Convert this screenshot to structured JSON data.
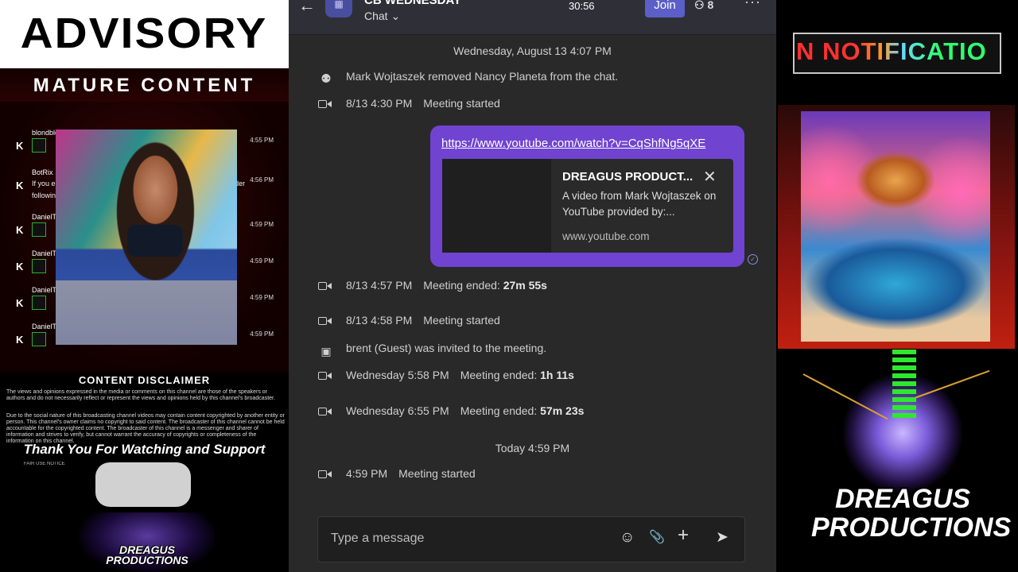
{
  "overlay_left": {
    "advisory": "ADVISORY",
    "mature": "MATURE CONTENT",
    "stream_chat": [
      {
        "user": "blondblondbz",
        "message": "",
        "time": "4:55 PM"
      },
      {
        "user": "BotRix",
        "message": "If you enjoy the content and would like to see more please consider following and activating notifications!",
        "time": "4:56 PM"
      },
      {
        "user": "DanielTrika",
        "message": "",
        "time": "4:59 PM"
      },
      {
        "user": "DanielTrika",
        "message": "",
        "time": "4:59 PM"
      },
      {
        "user": "DanielTrika",
        "message": "",
        "time": "4:59 PM"
      },
      {
        "user": "DanielTrika",
        "message": "",
        "time": "4:59 PM"
      }
    ],
    "platform_letter": "K",
    "disclaimer_title": "CONTENT DISCLAIMER",
    "disclaimer_1": "The views and opinions expressed in the media or comments on this channel are those of the speakers or authors and do not necessarily reflect or represent the views and opinions held by this channel's broadcaster.",
    "disclaimer_2": "Due to the social nature of this broadcasting channel videos may contain content copyrighted by another entity or person. This channel's owner claims no copyright to said content. The broadcaster of this channel cannot be held accountable for the copyrighted content. The broadcaster of this channel is a messenger and sharer of information and strives to verify, but cannot warrant the accuracy of copyrights or completeness of the information on this channel.",
    "thanks": "Thank You For Watching and Support",
    "fair_use_title": "FAIR USE NOTICE",
    "logo_text": "DREAGUS PRODUCTIONS"
  },
  "teams": {
    "chat_title": "CB WEDNESDAY",
    "chat_subtitle": "Chat ⌄",
    "group_avatar_icon": "calendar-icon",
    "call_timer": "30:56",
    "join_label": "Join",
    "people_count": "8",
    "more_label": "···",
    "day_dividers": [
      "Wednesday, August 13 4:07 PM",
      "Today 4:59 PM"
    ],
    "events": [
      {
        "icon": "person-removed-icon",
        "time": "",
        "text": "Mark Wojtaszek removed Nancy Planeta from the chat.",
        "bold": ""
      },
      {
        "icon": "camera-icon",
        "time": "8/13 4:30 PM",
        "text": "Meeting started",
        "bold": ""
      },
      {
        "icon": "camera-icon",
        "time": "8/13 4:57 PM",
        "text": "Meeting ended:",
        "bold": "27m 55s"
      },
      {
        "icon": "camera-icon",
        "time": "8/13 4:58 PM",
        "text": "Meeting started",
        "bold": ""
      },
      {
        "icon": "calendar-invite-icon",
        "time": "",
        "text": "brent (Guest) was invited to the meeting.",
        "bold": ""
      },
      {
        "icon": "camera-icon",
        "time": "Wednesday 5:58 PM",
        "text": "Meeting ended:",
        "bold": "1h 11s"
      },
      {
        "icon": "camera-icon",
        "time": "Wednesday 6:55 PM",
        "text": "Meeting ended:",
        "bold": "57m 23s"
      },
      {
        "icon": "camera-icon",
        "time": "4:59 PM",
        "text": "Meeting started",
        "bold": ""
      }
    ],
    "message": {
      "link": "https://www.youtube.com/watch?v=CqShfNg5qXE",
      "preview_title": "DREAGUS PRODUCT...",
      "preview_desc": "A video from Mark Wojtaszek on YouTube provided by:...",
      "preview_domain": "www.youtube.com",
      "status_icon": "seen-check-icon"
    },
    "composer": {
      "placeholder": "Type a message",
      "emoji_icon": "☺",
      "attach_icon": "📎",
      "add_icon": "+",
      "send_icon": "➤"
    }
  },
  "overlay_right": {
    "notification_marquee": "N NOTIFICATIO",
    "logo_text": "DREAGUS PRODUCTIONS"
  },
  "colors": {
    "teams_bg": "#292929",
    "bubble": "#7044d0",
    "join": "#5b5fc7",
    "accent_green": "#2ee82e",
    "accent_red": "#c02010"
  }
}
